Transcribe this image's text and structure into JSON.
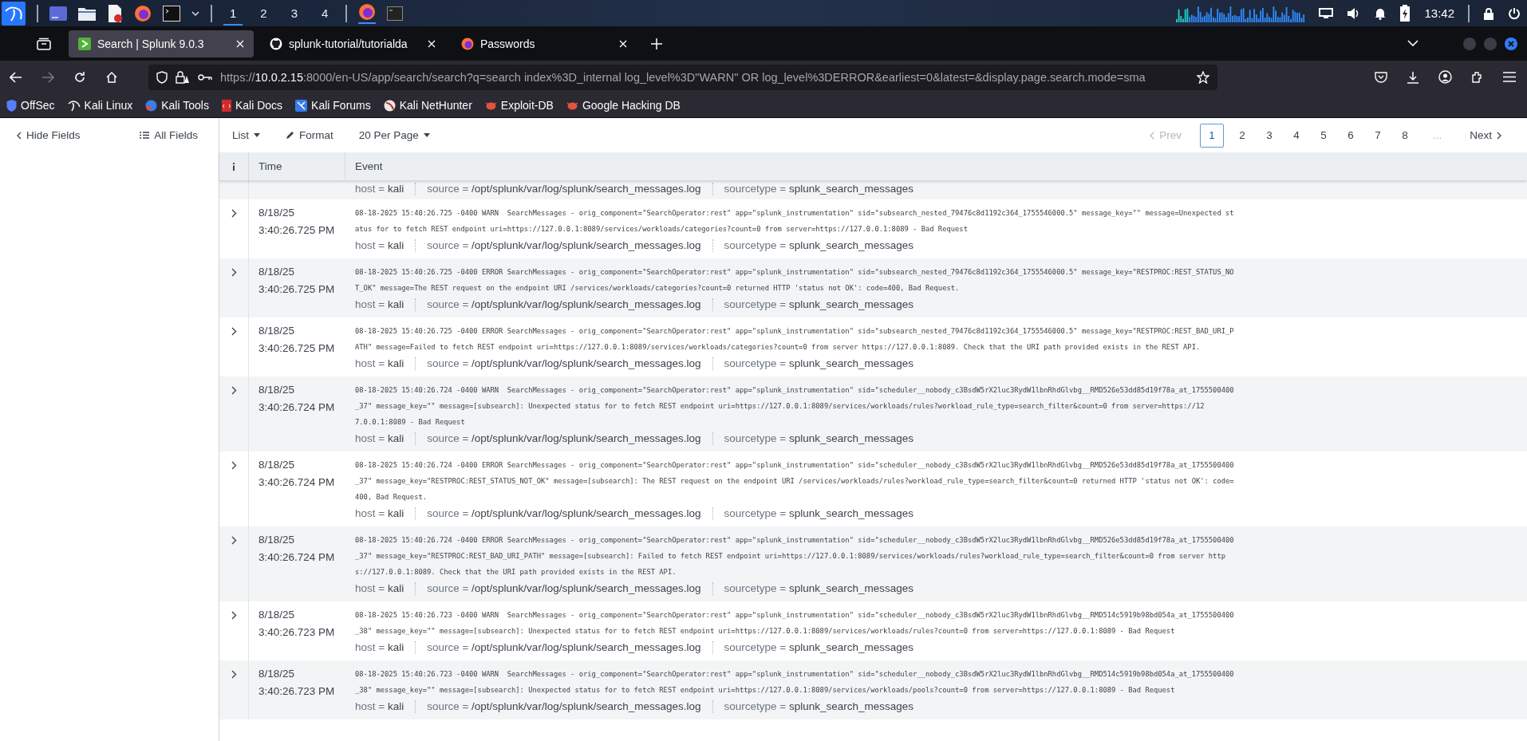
{
  "taskbar": {
    "workspaces": [
      {
        "label": "1",
        "selected": true
      },
      {
        "label": "2",
        "selected": false
      },
      {
        "label": "3",
        "selected": false
      },
      {
        "label": "4",
        "selected": false
      }
    ],
    "clock": "13:42"
  },
  "browser": {
    "tabs": [
      {
        "title": "Search | Splunk 9.0.3",
        "selected": true,
        "kind": "splunk"
      },
      {
        "title": "splunk-tutorial/tutorialda",
        "selected": false,
        "kind": "github"
      },
      {
        "title": "Passwords",
        "selected": false,
        "kind": "firefox"
      }
    ],
    "url": {
      "scheme": "https://",
      "host": "10.0.2.15",
      "rest": ":8000/en-US/app/search/search?q=search index%3D_internal log_level%3D\"WARN\" OR log_level%3DERROR&earliest=0&latest=&display.page.search.mode=sma"
    },
    "bookmarks": [
      {
        "label": "OffSec",
        "kind": "offsec"
      },
      {
        "label": "Kali Linux",
        "kind": "dragon"
      },
      {
        "label": "Kali Tools",
        "kind": "tools"
      },
      {
        "label": "Kali Docs",
        "kind": "docs"
      },
      {
        "label": "Kali Forums",
        "kind": "forums"
      },
      {
        "label": "Kali NetHunter",
        "kind": "nethunter"
      },
      {
        "label": "Exploit-DB",
        "kind": "bug"
      },
      {
        "label": "Google Hacking DB",
        "kind": "bug"
      }
    ]
  },
  "splunk": {
    "hide_fields": "Hide Fields",
    "all_fields": "All Fields",
    "list": "List",
    "format": "Format",
    "per_page": "20 Per Page",
    "pagination": {
      "prev": "Prev",
      "prev_disabled": true,
      "pages": [
        {
          "label": "1",
          "selected": true
        },
        {
          "label": "2",
          "selected": false
        },
        {
          "label": "3",
          "selected": false
        },
        {
          "label": "4",
          "selected": false
        },
        {
          "label": "5",
          "selected": false
        },
        {
          "label": "6",
          "selected": false
        },
        {
          "label": "7",
          "selected": false
        },
        {
          "label": "8",
          "selected": false
        }
      ],
      "ellipsis": "...",
      "next": "Next"
    },
    "columns": [
      "Time",
      "Event"
    ],
    "events": [
      {
        "kind": "partial",
        "fields": [
          {
            "label": "host =",
            "value": "kali"
          },
          {
            "label": "source =",
            "value": "/opt/splunk/var/log/splunk/search_messages.log"
          },
          {
            "label": "sourcetype =",
            "value": "splunk_search_messages"
          }
        ]
      },
      {
        "kind": "event",
        "date": "8/18/25",
        "time": "3:40:26.725 PM",
        "lines": [
          "08-18-2025 15:40:26.725 -0400 WARN  SearchMessages - orig_component=\"SearchOperator:rest\" app=\"splunk_instrumentation\" sid=\"subsearch_nested_79476c8d1192c364_1755546000.5\" message_key=\"\" message=Unexpected st",
          "atus for to fetch REST endpoint uri=https://127.0.0.1:8089/services/workloads/categories?count=0 from server=https://127.0.0.1:8089 - Bad Request"
        ],
        "fields": [
          {
            "label": "host =",
            "value": "kali"
          },
          {
            "label": "source =",
            "value": "/opt/splunk/var/log/splunk/search_messages.log"
          },
          {
            "label": "sourcetype =",
            "value": "splunk_search_messages"
          }
        ]
      },
      {
        "kind": "event",
        "date": "8/18/25",
        "time": "3:40:26.725 PM",
        "lines": [
          "08-18-2025 15:40:26.725 -0400 ERROR SearchMessages - orig_component=\"SearchOperator:rest\" app=\"splunk_instrumentation\" sid=\"subsearch_nested_79476c8d1192c364_1755546000.5\" message_key=\"RESTPROC:REST_STATUS_NO",
          "T_OK\" message=The REST request on the endpoint URI /services/workloads/categories?count=0 returned HTTP 'status not OK': code=400, Bad Request."
        ],
        "fields": [
          {
            "label": "host =",
            "value": "kali"
          },
          {
            "label": "source =",
            "value": "/opt/splunk/var/log/splunk/search_messages.log"
          },
          {
            "label": "sourcetype =",
            "value": "splunk_search_messages"
          }
        ]
      },
      {
        "kind": "event",
        "date": "8/18/25",
        "time": "3:40:26.725 PM",
        "lines": [
          "08-18-2025 15:40:26.725 -0400 ERROR SearchMessages - orig_component=\"SearchOperator:rest\" app=\"splunk_instrumentation\" sid=\"subsearch_nested_79476c8d1192c364_1755546000.5\" message_key=\"RESTPROC:REST_BAD_URI_P",
          "ATH\" message=Failed to fetch REST endpoint uri=https://127.0.0.1:8089/services/workloads/categories?count=0 from server https://127.0.0.1:8089. Check that the URI path provided exists in the REST API."
        ],
        "fields": [
          {
            "label": "host =",
            "value": "kali"
          },
          {
            "label": "source =",
            "value": "/opt/splunk/var/log/splunk/search_messages.log"
          },
          {
            "label": "sourcetype =",
            "value": "splunk_search_messages"
          }
        ]
      },
      {
        "kind": "event",
        "date": "8/18/25",
        "time": "3:40:26.724 PM",
        "lines": [
          "08-18-2025 15:40:26.724 -0400 WARN  SearchMessages - orig_component=\"SearchOperator:rest\" app=\"splunk_instrumentation\" sid=\"scheduler__nobody_c3BsdW5rX2luc3RydW1lbnRhdGlvbg__RMD526e53dd85d19f78a_at_1755500400",
          "_37\" message_key=\"\" message=[subsearch]: Unexpected status for to fetch REST endpoint uri=https://127.0.0.1:8089/services/workloads/rules?workload_rule_type=search_filter&count=0 from server=https://12",
          "7.0.0.1:8089 - Bad Request"
        ],
        "fields": [
          {
            "label": "host =",
            "value": "kali"
          },
          {
            "label": "source =",
            "value": "/opt/splunk/var/log/splunk/search_messages.log"
          },
          {
            "label": "sourcetype =",
            "value": "splunk_search_messages"
          }
        ]
      },
      {
        "kind": "event",
        "date": "8/18/25",
        "time": "3:40:26.724 PM",
        "lines": [
          "08-18-2025 15:40:26.724 -0400 ERROR SearchMessages - orig_component=\"SearchOperator:rest\" app=\"splunk_instrumentation\" sid=\"scheduler__nobody_c3BsdW5rX2luc3RydW1lbnRhdGlvbg__RMD526e53dd85d19f78a_at_1755500400",
          "_37\" message_key=\"RESTPROC:REST_STATUS_NOT_OK\" message=[subsearch]: The REST request on the endpoint URI /services/workloads/rules?workload_rule_type=search_filter&count=0 returned HTTP 'status not OK': code=",
          "400, Bad Request."
        ],
        "fields": [
          {
            "label": "host =",
            "value": "kali"
          },
          {
            "label": "source =",
            "value": "/opt/splunk/var/log/splunk/search_messages.log"
          },
          {
            "label": "sourcetype =",
            "value": "splunk_search_messages"
          }
        ]
      },
      {
        "kind": "event",
        "date": "8/18/25",
        "time": "3:40:26.724 PM",
        "lines": [
          "08-18-2025 15:40:26.724 -0400 ERROR SearchMessages - orig_component=\"SearchOperator:rest\" app=\"splunk_instrumentation\" sid=\"scheduler__nobody_c3BsdW5rX2luc3RydW1lbnRhdGlvbg__RMD526e53dd85d19f78a_at_1755500400",
          "_37\" message_key=\"RESTPROC:REST_BAD_URI_PATH\" message=[subsearch]: Failed to fetch REST endpoint uri=https://127.0.0.1:8089/services/workloads/rules?workload_rule_type=search_filter&count=0 from server http",
          "s://127.0.0.1:8089. Check that the URI path provided exists in the REST API."
        ],
        "fields": [
          {
            "label": "host =",
            "value": "kali"
          },
          {
            "label": "source =",
            "value": "/opt/splunk/var/log/splunk/search_messages.log"
          },
          {
            "label": "sourcetype =",
            "value": "splunk_search_messages"
          }
        ]
      },
      {
        "kind": "event",
        "date": "8/18/25",
        "time": "3:40:26.723 PM",
        "lines": [
          "08-18-2025 15:40:26.723 -0400 WARN  SearchMessages - orig_component=\"SearchOperator:rest\" app=\"splunk_instrumentation\" sid=\"scheduler__nobody_c3BsdW5rX2luc3RydW1lbnRhdGlvbg__RMD514c5919b98bd054a_at_1755500400",
          "_38\" message_key=\"\" message=[subsearch]: Unexpected status for to fetch REST endpoint uri=https://127.0.0.1:8089/services/workloads/rules?count=0 from server=https://127.0.0.1:8089 - Bad Request"
        ],
        "fields": [
          {
            "label": "host =",
            "value": "kali"
          },
          {
            "label": "source =",
            "value": "/opt/splunk/var/log/splunk/search_messages.log"
          },
          {
            "label": "sourcetype =",
            "value": "splunk_search_messages"
          }
        ]
      },
      {
        "kind": "event",
        "date": "8/18/25",
        "time": "3:40:26.723 PM",
        "lines": [
          "08-18-2025 15:40:26.723 -0400 WARN  SearchMessages - orig_component=\"SearchOperator:rest\" app=\"splunk_instrumentation\" sid=\"scheduler__nobody_c3BsdW5rX2luc3RydW1lbnRhdGlvbg__RMD514c5919b98bd054a_at_1755500400",
          "_38\" message_key=\"\" message=[subsearch]: Unexpected status for to fetch REST endpoint uri=https://127.0.0.1:8089/services/workloads/pools?count=0 from server=https://127.0.0.1:8089 - Bad Request"
        ],
        "fields": [
          {
            "label": "host =",
            "value": "kali"
          },
          {
            "label": "source =",
            "value": "/opt/splunk/var/log/splunk/search_messages.log"
          },
          {
            "label": "sourcetype =",
            "value": "splunk_search_messages"
          }
        ]
      }
    ]
  }
}
